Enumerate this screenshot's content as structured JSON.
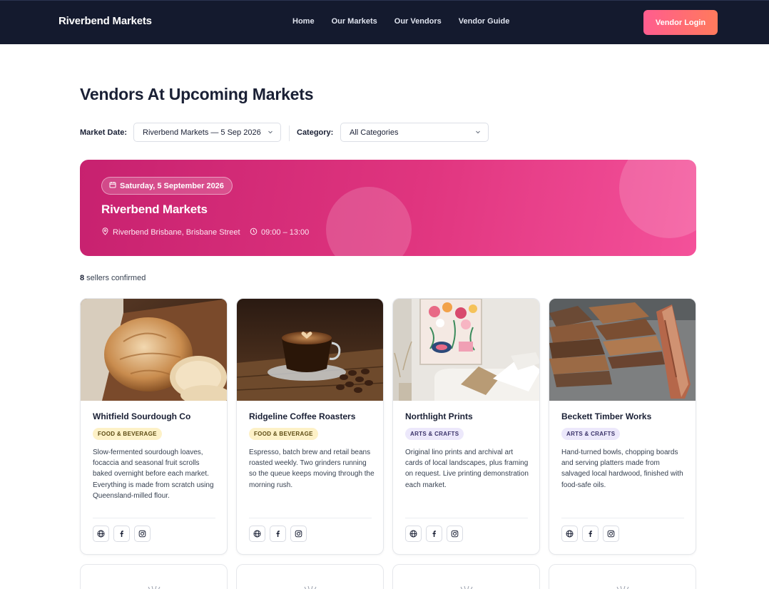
{
  "nav": {
    "brand": "Riverbend Markets",
    "links": [
      "Home",
      "Our Markets",
      "Our Vendors",
      "Vendor Guide"
    ],
    "login_label": "Vendor Login"
  },
  "page": {
    "title": "Vendors At Upcoming Markets"
  },
  "filters": {
    "date_label": "Market Date:",
    "date_value": "Riverbend Markets — 5 Sep 2026",
    "category_label": "Category:",
    "category_value": "All Categories"
  },
  "banner": {
    "date": "Saturday, 5 September 2026",
    "title": "Riverbend Markets",
    "location": "Riverbend Brisbane, Brisbane Street",
    "time": "09:00 – 13:00"
  },
  "sellers": {
    "count": "8",
    "suffix": " sellers confirmed"
  },
  "vendors": [
    {
      "name": "Whitfield Sourdough Co",
      "category": "FOOD & BEVERAGE",
      "description": "Slow-fermented sourdough loaves, focaccia and seasonal fruit scrolls baked overnight before each market. Everything is made from scratch using Queensland-milled flour."
    },
    {
      "name": "Ridgeline Coffee Roasters",
      "category": "FOOD & BEVERAGE",
      "description": "Espresso, batch brew and retail beans roasted weekly. Two grinders running so the queue keeps moving through the morning rush."
    },
    {
      "name": "Northlight Prints",
      "category": "ARTS & CRAFTS",
      "description": "Original lino prints and archival art cards of local landscapes, plus framing on request. Live printing demonstration each market."
    },
    {
      "name": "Beckett Timber Works",
      "category": "ARTS & CRAFTS",
      "description": "Hand-turned bowls, chopping boards and serving platters made from salvaged local hardwood, finished with food-safe oils."
    }
  ],
  "icons": {
    "social": [
      "globe-icon",
      "facebook-icon",
      "instagram-icon"
    ],
    "calendar": "calendar-icon",
    "location": "location-pin-icon",
    "clock": "clock-icon"
  },
  "colors": {
    "nav_bg": "#141a2e",
    "accent_start": "#ff5d8f",
    "accent_end": "#ff7a5c",
    "banner_start": "#c7216f",
    "banner_end": "#f4519a",
    "food_badge": "#fdf1c7",
    "arts_badge": "#ece8fb"
  }
}
